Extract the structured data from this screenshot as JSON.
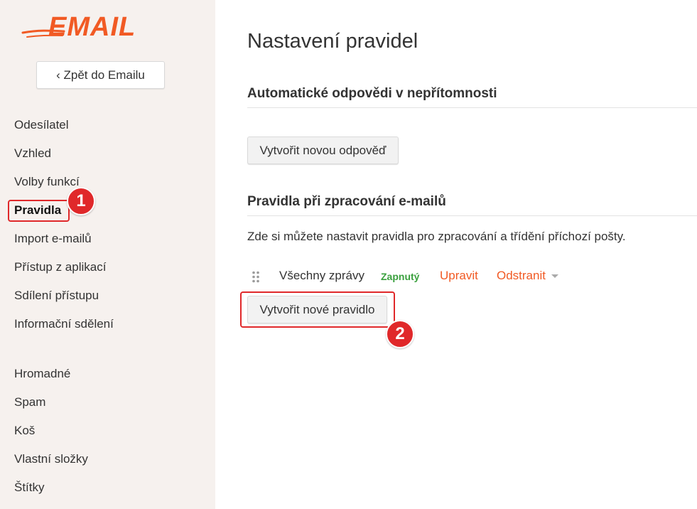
{
  "sidebar": {
    "logo_text": "EMAIL",
    "back_button": "‹ Zpět do Emailu",
    "settings_items": [
      {
        "label": "Odesílatel"
      },
      {
        "label": "Vzhled"
      },
      {
        "label": "Volby funkcí"
      },
      {
        "label": "Pravidla",
        "active": true
      },
      {
        "label": "Import e-mailů"
      },
      {
        "label": "Přístup z aplikací"
      },
      {
        "label": "Sdílení přístupu"
      },
      {
        "label": "Informační sdělení"
      }
    ],
    "folder_items": [
      {
        "label": "Hromadné"
      },
      {
        "label": "Spam"
      },
      {
        "label": "Koš"
      },
      {
        "label": "Vlastní složky"
      },
      {
        "label": "Štítky"
      }
    ]
  },
  "main": {
    "title": "Nastavení pravidel",
    "auto_reply": {
      "heading": "Automatické odpovědi v nepřítomnosti",
      "button": "Vytvořit novou odpověď"
    },
    "rules": {
      "heading": "Pravidla při zpracování e-mailů",
      "description": "Zde si můžete nastavit pravidla pro zpracování a třídění příchozí pošty.",
      "items": [
        {
          "name": "Všechny zprávy",
          "status": "Zapnutý",
          "edit": "Upravit",
          "delete": "Odstranit"
        }
      ],
      "button": "Vytvořit nové pravidlo"
    }
  },
  "annotations": {
    "badge_1": "1",
    "badge_2": "2"
  },
  "colors": {
    "brand": "#f15a24",
    "status_on": "#3aa03e",
    "annotation": "#e0282a",
    "sidebar_bg": "#f6f1ee"
  }
}
